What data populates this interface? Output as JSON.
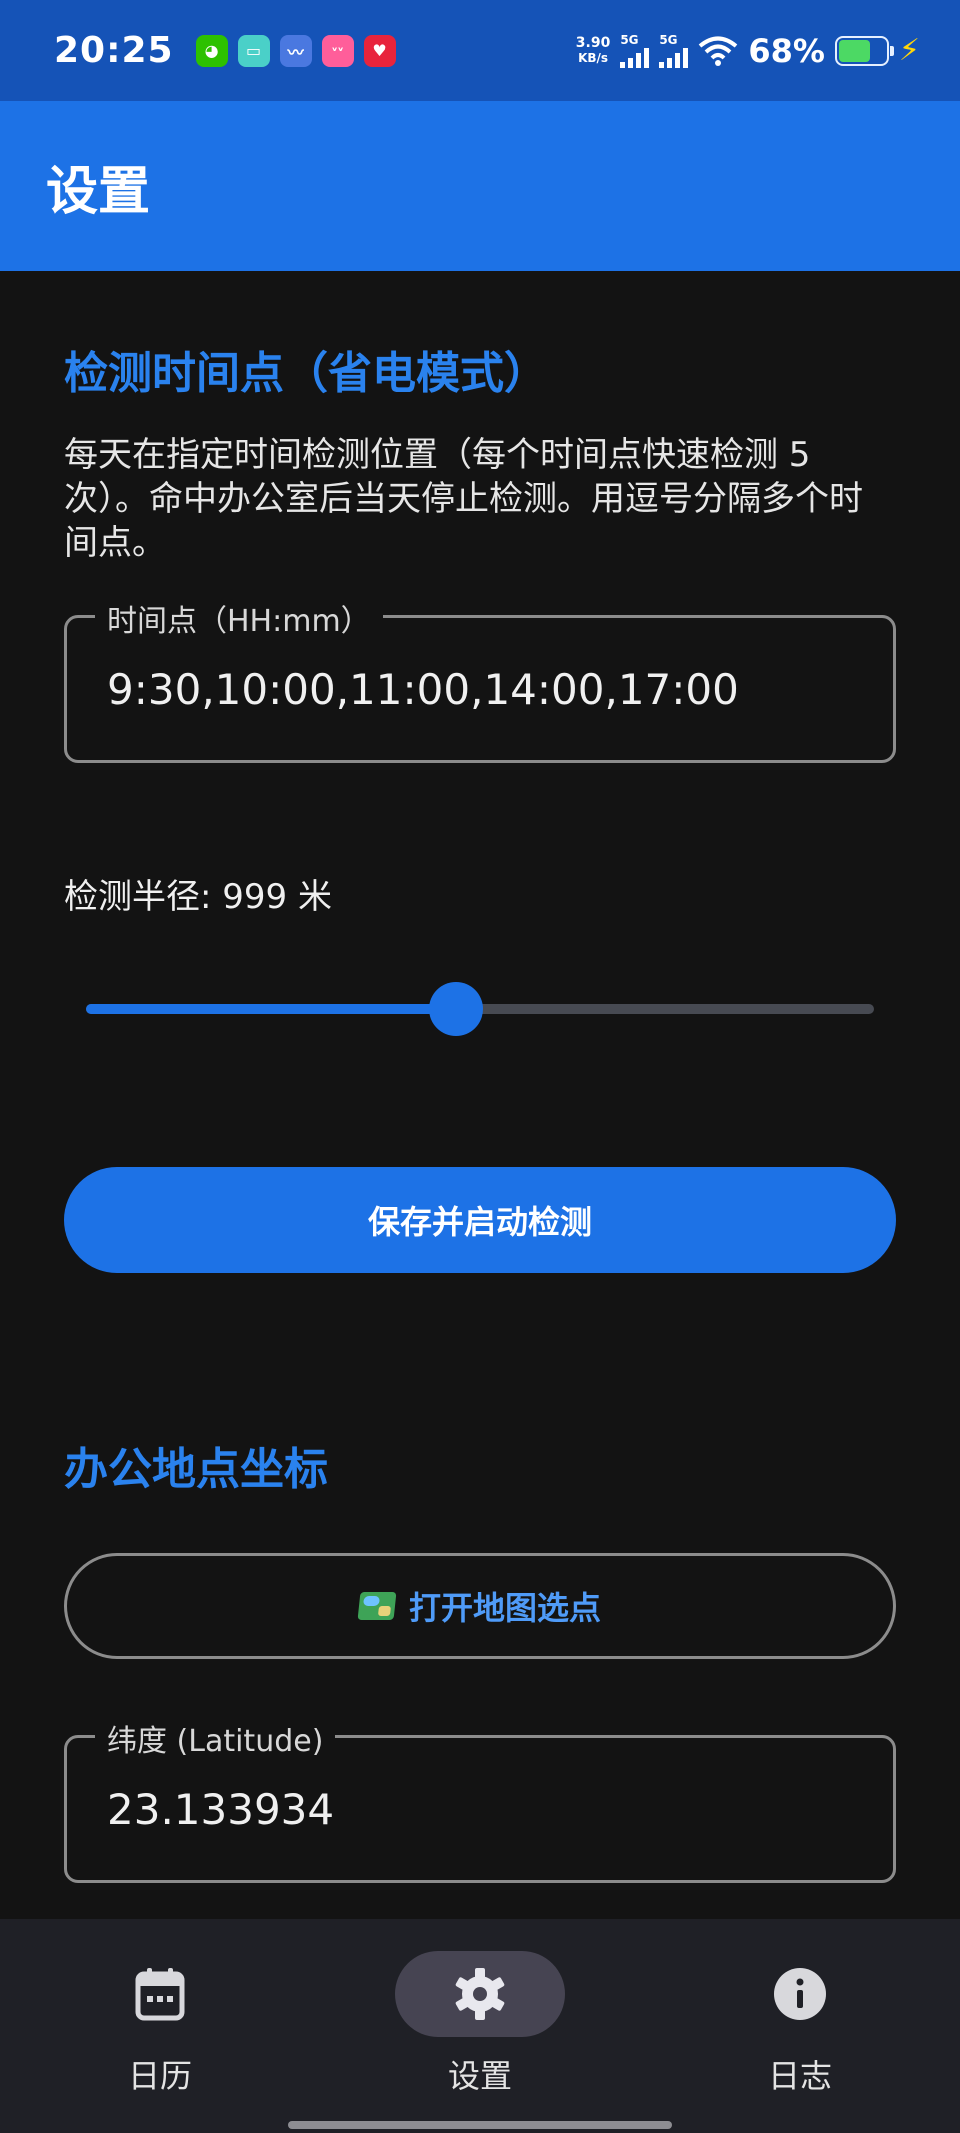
{
  "status_bar": {
    "time": "20:25",
    "apps": [
      {
        "icon": "wechat-icon",
        "color": "#2dc100",
        "glyph": "◕"
      },
      {
        "icon": "chat-app-icon",
        "color": "#4ad0c8",
        "glyph": "▭"
      },
      {
        "icon": "wave-app-icon",
        "color": "#4a78e0",
        "glyph": "〰"
      },
      {
        "icon": "lolo-app-icon",
        "color": "#ff5e9a",
        "glyph": "ᵛᵛ"
      },
      {
        "icon": "heart-app-icon",
        "color": "#e8243c",
        "glyph": "♥"
      }
    ],
    "net_speed_value": "3.90",
    "net_speed_unit": "KB/s",
    "sim1_tag": "5G",
    "sim2_tag": "5G",
    "battery_percent": "68%",
    "battery_level": 0.68
  },
  "app_bar": {
    "title": "设置"
  },
  "detection": {
    "section_title": "检测时间点（省电模式）",
    "description": "每天在指定时间检测位置（每个时间点快速检测 5 次）。命中办公室后当天停止检测。用逗号分隔多个时间点。",
    "time_field_label": "时间点（HH:mm）",
    "time_field_value": "9:30,10:00,11:00,14:00,17:00",
    "radius_label": "检测半径: 999 米",
    "slider_fraction": 0.47,
    "save_button_label": "保存并启动检测"
  },
  "office": {
    "section_title": "办公地点坐标",
    "open_map_button_label": "打开地图选点",
    "latitude_label": "纬度 (Latitude)",
    "latitude_value": "23.133934"
  },
  "bottom_nav": {
    "items": [
      {
        "label": "日历",
        "icon": "calendar-icon"
      },
      {
        "label": "设置",
        "icon": "gear-icon",
        "active": true
      },
      {
        "label": "日志",
        "icon": "info-icon"
      }
    ]
  },
  "colors": {
    "accent": "#1d72e6",
    "status_bar": "#1553b7",
    "background": "#131313",
    "nav_background": "#1f2026",
    "section_title": "#2a82ee"
  }
}
